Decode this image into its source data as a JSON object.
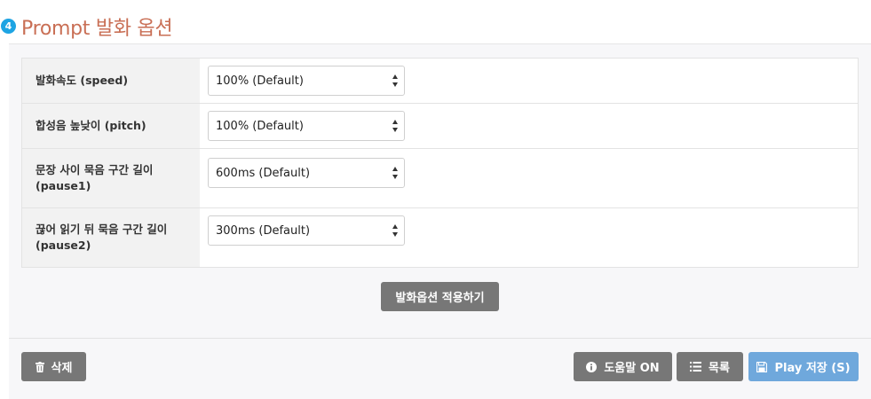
{
  "section": {
    "step_number": "4",
    "title": "Prompt 발화 옵션"
  },
  "options": [
    {
      "label": "발화속도 (speed)",
      "value": "100% (Default)"
    },
    {
      "label": "합성음 높낮이 (pitch)",
      "value": "100% (Default)"
    },
    {
      "label": "문장 사이 묵음 구간 길이\n(pause1)",
      "value": "600ms (Default)"
    },
    {
      "label": "끊어 읽기 뒤 묵음 구간 길이\n(pause2)",
      "value": "300ms (Default)"
    }
  ],
  "apply_button_label": "발화옵션 적용하기",
  "footer": {
    "delete_label": "삭제",
    "help_label": "도움말 ON",
    "list_label": "목록",
    "play_save_label": "Play 저장 (S)"
  },
  "colors": {
    "title": "#c96f55",
    "step_badge": "#1ea4e3",
    "gray_button": "#777777",
    "blue_button": "#6fa8dc"
  },
  "icons": {
    "delete": "trash-icon",
    "help": "info-circle-icon",
    "list": "list-icon",
    "save": "floppy-disk-icon"
  }
}
